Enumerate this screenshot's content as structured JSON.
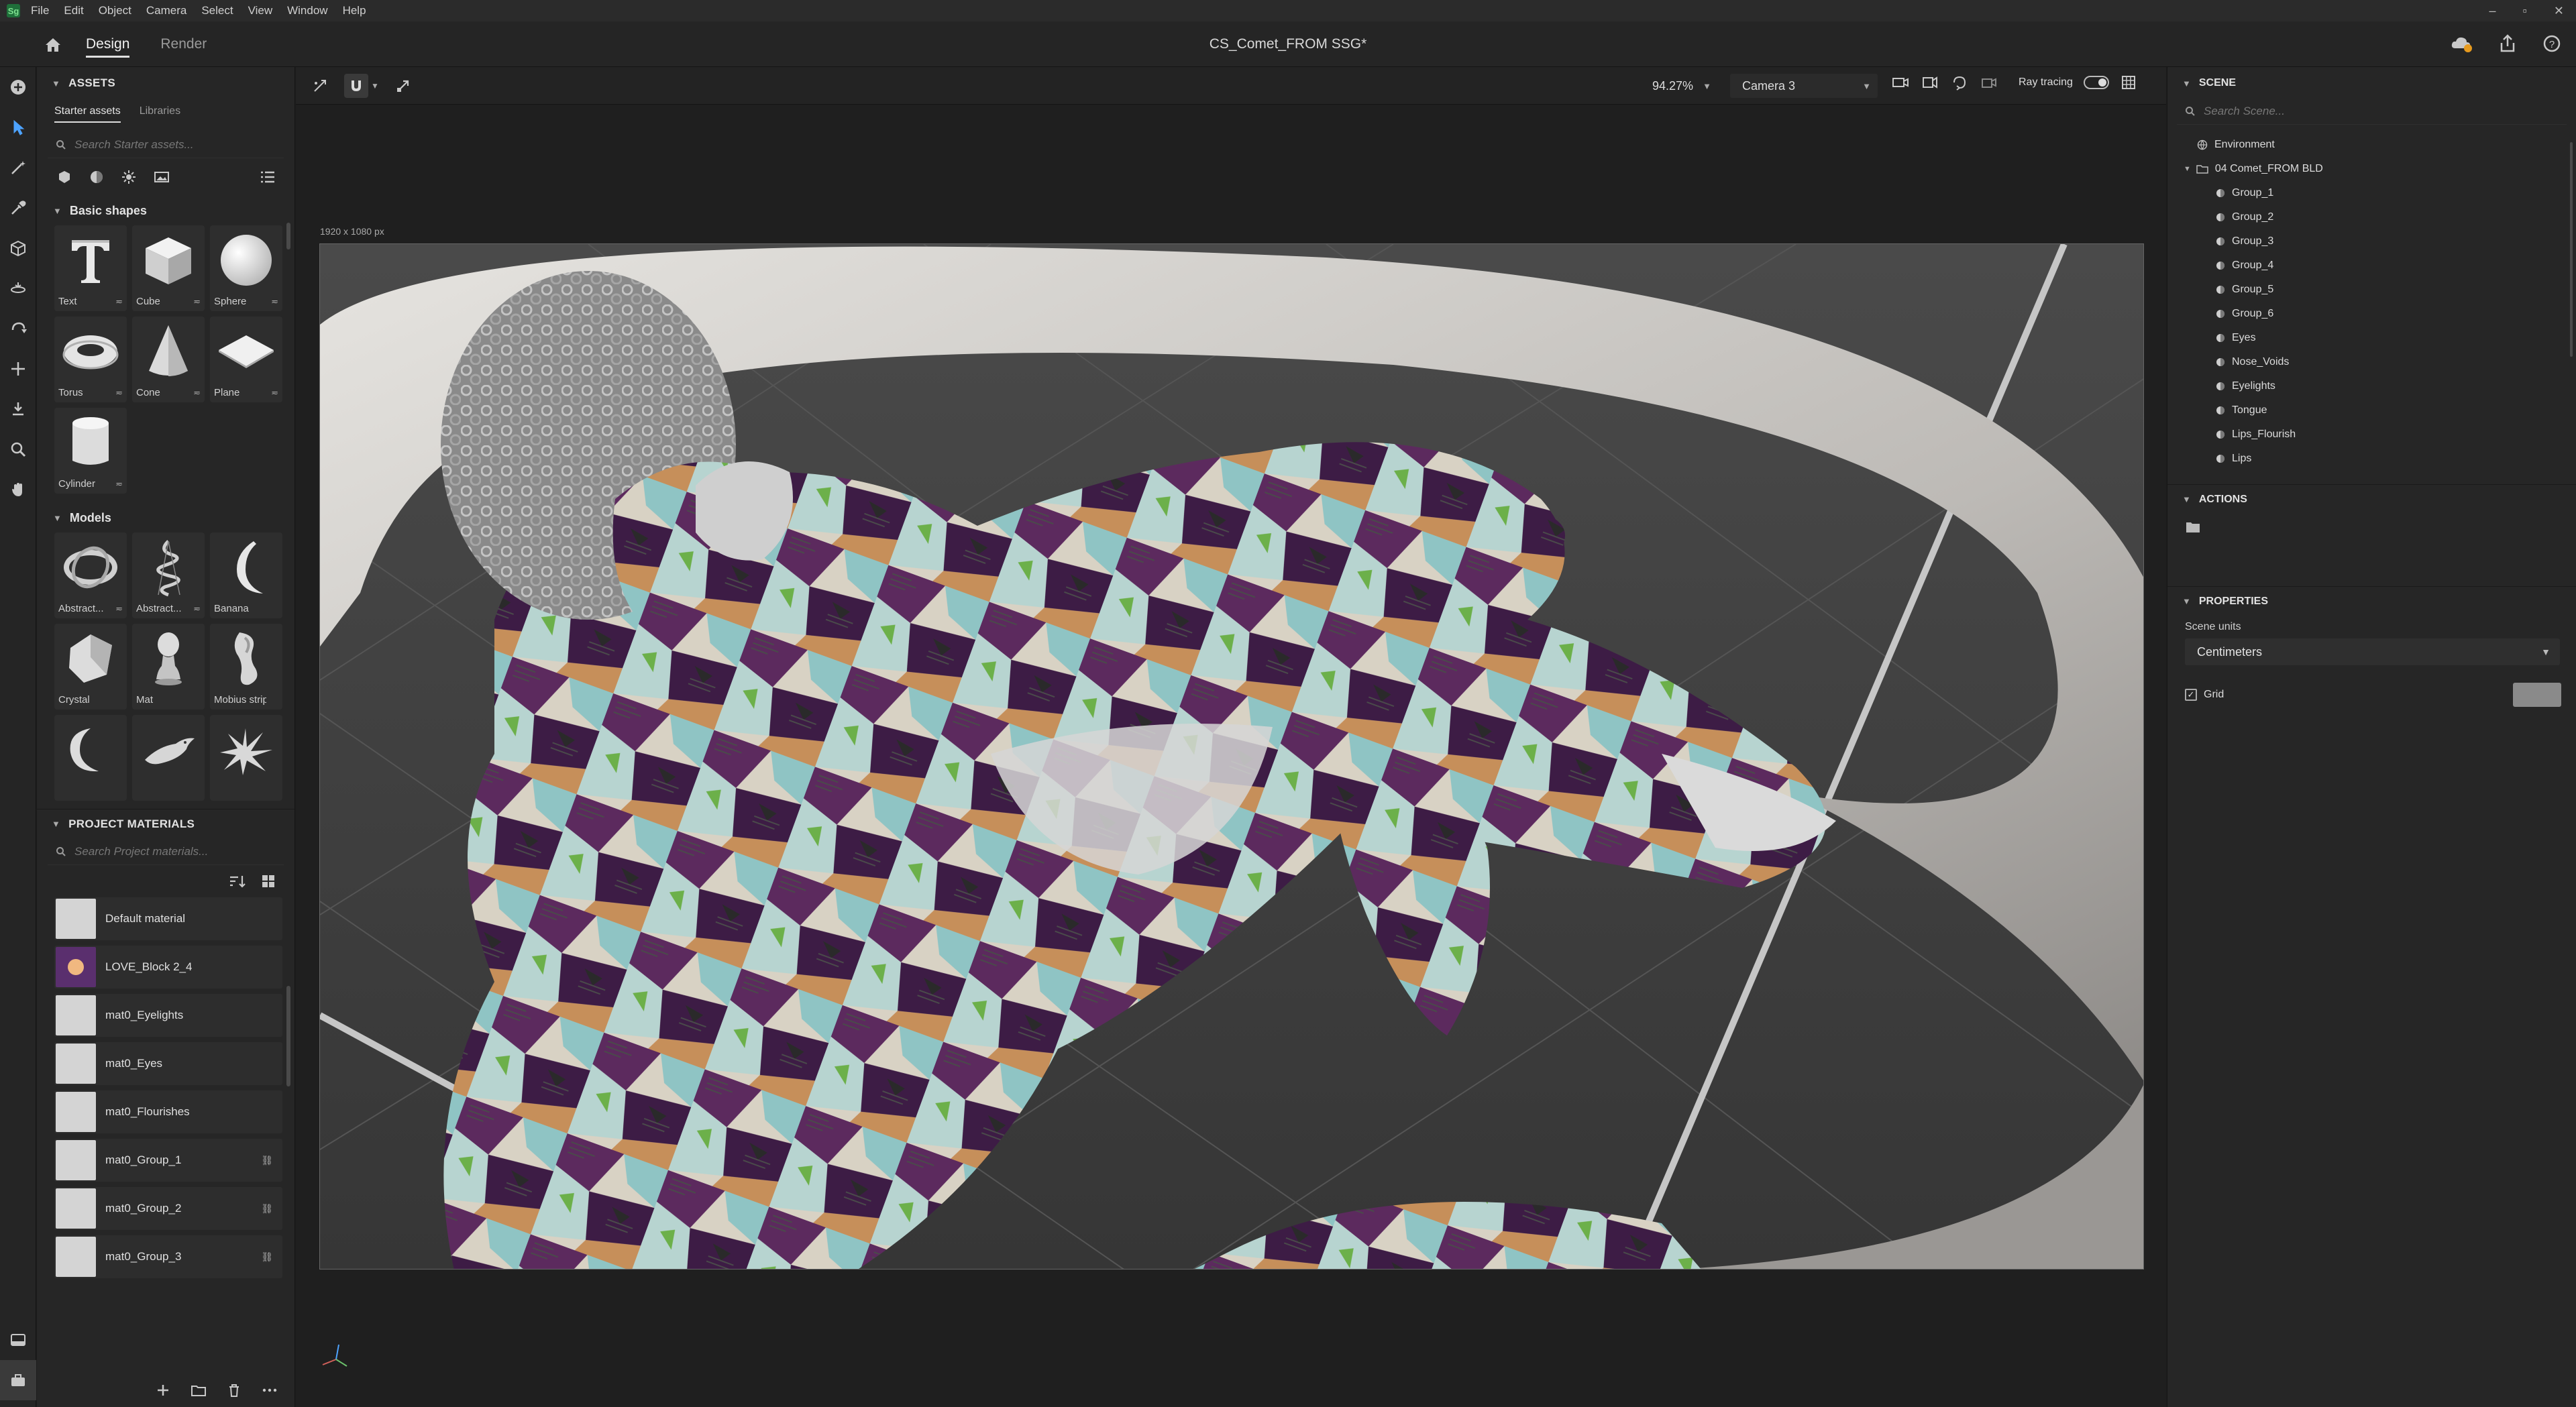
{
  "menubar": {
    "logo": "Sg",
    "items": [
      "File",
      "Edit",
      "Object",
      "Camera",
      "Select",
      "View",
      "Window",
      "Help"
    ]
  },
  "titlebar": {
    "tabs": [
      {
        "label": "Design",
        "active": true
      },
      {
        "label": "Render",
        "active": false
      }
    ],
    "document_title": "CS_Comet_FROM SSG*"
  },
  "assets": {
    "title": "ASSETS",
    "subtabs": [
      "Starter assets",
      "Libraries"
    ],
    "search_placeholder": "Search Starter assets...",
    "basic_shapes": {
      "title": "Basic shapes",
      "items": [
        "Text",
        "Cube",
        "Sphere",
        "Torus",
        "Cone",
        "Plane",
        "Cylinder"
      ]
    },
    "models": {
      "title": "Models",
      "items": [
        "Abstract...",
        "Abstract...",
        "Banana",
        "Crystal",
        "Mat",
        "Mobius strip"
      ]
    },
    "project_materials": {
      "title": "PROJECT MATERIALS",
      "search_placeholder": "Search Project materials...",
      "items": [
        {
          "name": "Default material",
          "linked": false
        },
        {
          "name": "LOVE_Block 2_4",
          "linked": false
        },
        {
          "name": "mat0_Eyelights",
          "linked": false
        },
        {
          "name": "mat0_Eyes",
          "linked": false
        },
        {
          "name": "mat0_Flourishes",
          "linked": false
        },
        {
          "name": "mat0_Group_1",
          "linked": true
        },
        {
          "name": "mat0_Group_2",
          "linked": true
        },
        {
          "name": "mat0_Group_3",
          "linked": true
        }
      ]
    }
  },
  "viewport": {
    "zoom": "94.27%",
    "camera": "Camera 3",
    "ray_tracing_label": "Ray tracing",
    "ray_tracing_on": true,
    "resolution_label": "1920 x 1080 px"
  },
  "scene": {
    "title": "SCENE",
    "search_placeholder": "Search Scene...",
    "environment": "Environment",
    "root": "04 Comet_FROM BLD",
    "children": [
      "Group_1",
      "Group_2",
      "Group_3",
      "Group_4",
      "Group_5",
      "Group_6",
      "Eyes",
      "Nose_Voids",
      "Eyelights",
      "Tongue",
      "Lips_Flourish",
      "Lips"
    ]
  },
  "actions": {
    "title": "ACTIONS"
  },
  "properties": {
    "title": "PROPERTIES",
    "scene_units_label": "Scene units",
    "scene_units_value": "Centimeters",
    "grid_label": "Grid",
    "grid_checked": true
  },
  "colors": {
    "accent": "#4da3ff",
    "panel": "#262626",
    "viewport_bg": "#1f1f1f"
  }
}
